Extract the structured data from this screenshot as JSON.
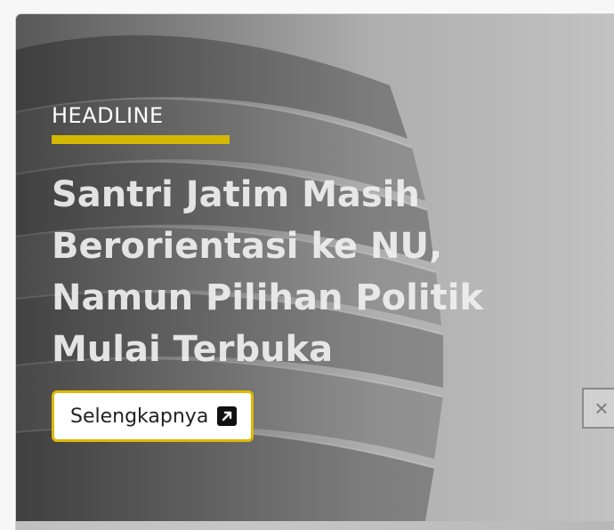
{
  "hero": {
    "kicker": "HEADLINE",
    "title": "Santri Jatim Masih Berorientasi ke NU, Namun Pilihan Politik Mulai Terbuka",
    "cta_label": "Selengkapnya",
    "cta_icon": "external-link-icon",
    "close_icon": "close-icon",
    "close_glyph": "×",
    "accent_color": "#d4b800"
  }
}
